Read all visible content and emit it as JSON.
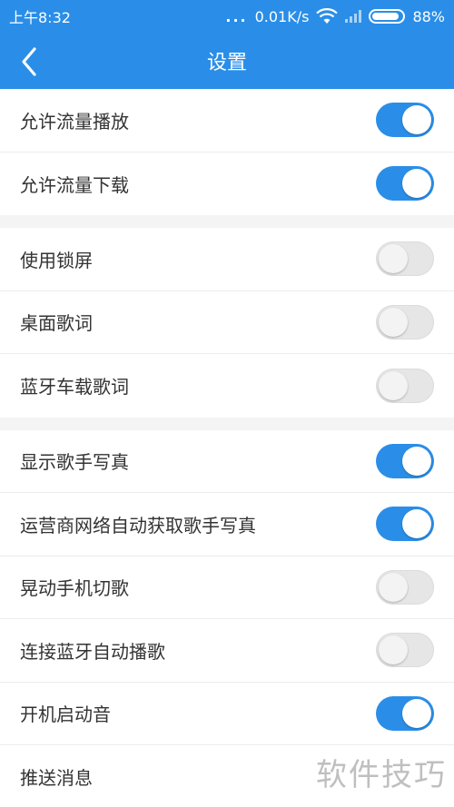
{
  "status": {
    "time": "上午8:32",
    "dots": "...",
    "speed": "0.01K/s",
    "battery": "88%",
    "battery_level": 0.88
  },
  "nav": {
    "title": "设置"
  },
  "groups": [
    {
      "items": [
        {
          "label": "允许流量播放",
          "on": true
        },
        {
          "label": "允许流量下载",
          "on": true
        }
      ]
    },
    {
      "items": [
        {
          "label": "使用锁屏",
          "on": false
        },
        {
          "label": "桌面歌词",
          "on": false
        },
        {
          "label": "蓝牙车载歌词",
          "on": false
        }
      ]
    },
    {
      "items": [
        {
          "label": "显示歌手写真",
          "on": true
        },
        {
          "label": "运营商网络自动获取歌手写真",
          "on": true
        },
        {
          "label": "晃动手机切歌",
          "on": false
        },
        {
          "label": "连接蓝牙自动播歌",
          "on": false
        },
        {
          "label": "开机启动音",
          "on": true
        },
        {
          "label": "推送消息"
        }
      ]
    }
  ],
  "watermark": "软件技巧",
  "colors": {
    "accent": "#2a8ee8",
    "switch_off": "#e6e6e6"
  }
}
